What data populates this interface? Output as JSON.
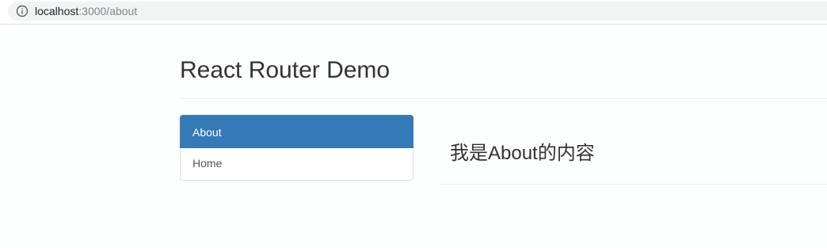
{
  "browser": {
    "url_host": "localhost",
    "url_path": ":3000/about",
    "info_icon": "info-circle-icon"
  },
  "page": {
    "title": "React Router Demo"
  },
  "nav": {
    "items": [
      {
        "label": "About",
        "active": true
      },
      {
        "label": "Home",
        "active": false
      }
    ]
  },
  "content": {
    "heading": "我是About的内容"
  },
  "colors": {
    "active_bg": "#337ab7",
    "active_text": "#ffffff",
    "border": "#dddddd",
    "text": "#333333"
  }
}
